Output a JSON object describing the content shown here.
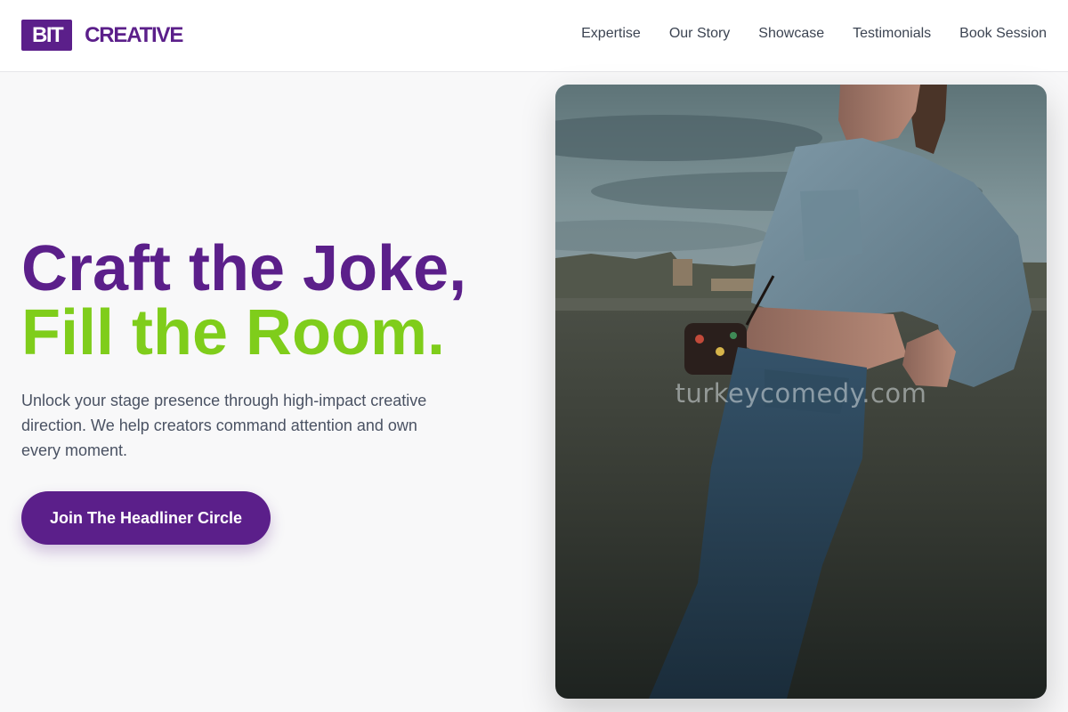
{
  "brand": {
    "mark": "BIT",
    "word": "CREATIVE"
  },
  "nav": {
    "items": [
      {
        "label": "Expertise"
      },
      {
        "label": "Our Story"
      },
      {
        "label": "Showcase"
      },
      {
        "label": "Testimonials"
      },
      {
        "label": "Book Session"
      }
    ]
  },
  "hero": {
    "title_line1": "Craft the Joke,",
    "title_line2": "Fill the Room.",
    "subtitle": "Unlock your stage presence through high-impact creative direction. We help creators command attention and own every moment.",
    "cta_label": "Join The Headliner Circle"
  },
  "image": {
    "watermark": "turkeycomedy.com"
  },
  "colors": {
    "brand_purple": "#5b1f8a",
    "accent_green": "#7fcd1b",
    "text_gray": "#4a5263"
  }
}
